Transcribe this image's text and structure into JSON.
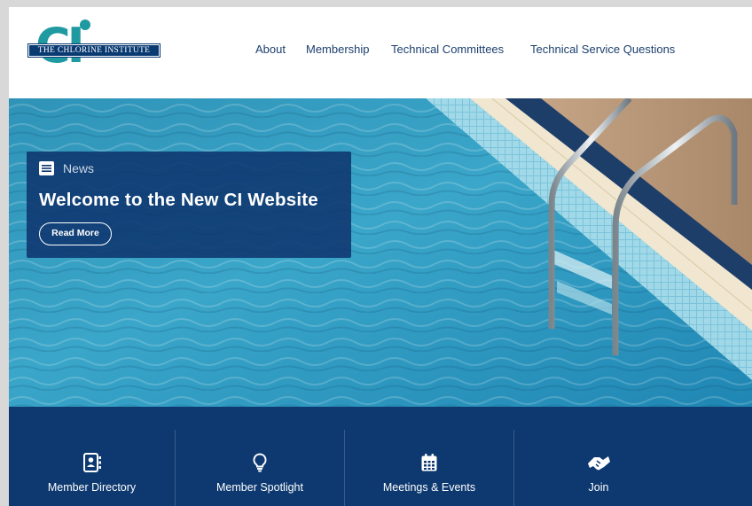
{
  "logo": {
    "mark": "CI",
    "name": "THE CHLORINE INSTITUTE"
  },
  "nav": {
    "items": [
      {
        "label": "About"
      },
      {
        "label": "Membership"
      },
      {
        "label": "Technical Committees"
      },
      {
        "label": "Technical Service Questions"
      }
    ]
  },
  "hero": {
    "news_label": "News",
    "news_icon": "news-icon",
    "title": "Welcome to the New CI Website",
    "cta_label": "Read More"
  },
  "quicklinks": [
    {
      "label": "Member Directory",
      "icon": "address-book-icon"
    },
    {
      "label": "Member Spotlight",
      "icon": "lightbulb-icon"
    },
    {
      "label": "Meetings & Events",
      "icon": "calendar-icon"
    },
    {
      "label": "Join",
      "icon": "handshake-icon"
    }
  ],
  "colors": {
    "brand_navy": "#0d3970",
    "brand_teal": "#1f9aa0",
    "nav_text": "#1b3f6e"
  }
}
